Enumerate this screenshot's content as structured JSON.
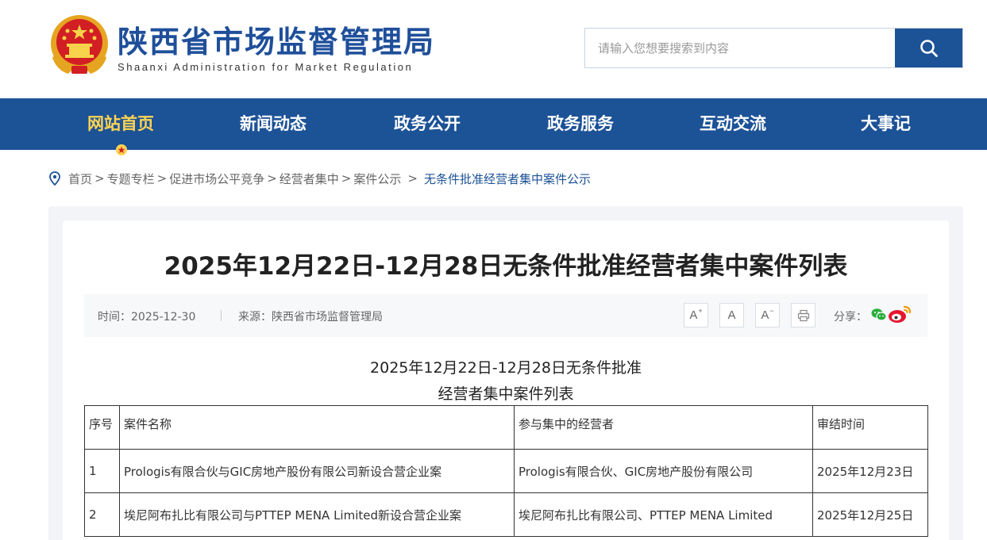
{
  "header": {
    "title": "陕西省市场监督管理局",
    "subtitle": "Shaanxi Administration for Market Regulation",
    "search_placeholder": "请输入您想要搜索到内容",
    "search_icon": "search-icon",
    "colors": {
      "brand": "#1c5296",
      "active_nav": "#ffd452"
    }
  },
  "nav": {
    "items": [
      {
        "label": "网站首页",
        "active": true
      },
      {
        "label": "新闻动态"
      },
      {
        "label": "政务公开"
      },
      {
        "label": "政务服务"
      },
      {
        "label": "互动交流"
      },
      {
        "label": "大事记"
      }
    ]
  },
  "breadcrumb": {
    "items": [
      "首页",
      "专题专栏",
      "促进市场公平竞争",
      "经营者集中",
      "案件公示"
    ],
    "separator": ">",
    "current": "无条件批准经营者集中案件公示"
  },
  "article": {
    "title": "2025年12月22日-12月28日无条件批准经营者集中案件列表",
    "time_label": "时间：",
    "time": "2025-12-30",
    "source_label": "来源：",
    "source": "陕西省市场监督管理局",
    "font_buttons": {
      "larger": "A",
      "larger_mark": "+",
      "normal": "A",
      "smaller": "A",
      "smaller_mark": "−"
    },
    "share_label": "分享：",
    "body_title_line1": "2025年12月22日-12月28日无条件批准",
    "body_title_line2": "经营者集中案件列表"
  },
  "table": {
    "headers": [
      "序号",
      "案件名称",
      "参与集中的经营者",
      "审结时间"
    ],
    "rows": [
      [
        "1",
        "Prologis有限合伙与GIC房地产股份有限公司新设合营企业案",
        "Prologis有限合伙、GIC房地产股份有限公司",
        "2025年12月23日"
      ],
      [
        "2",
        "埃尼阿布扎比有限公司与PTTEP MENA Limited新设合营企业案",
        "埃尼阿布扎比有限公司、PTTEP MENA Limited",
        "2025年12月25日"
      ]
    ]
  }
}
